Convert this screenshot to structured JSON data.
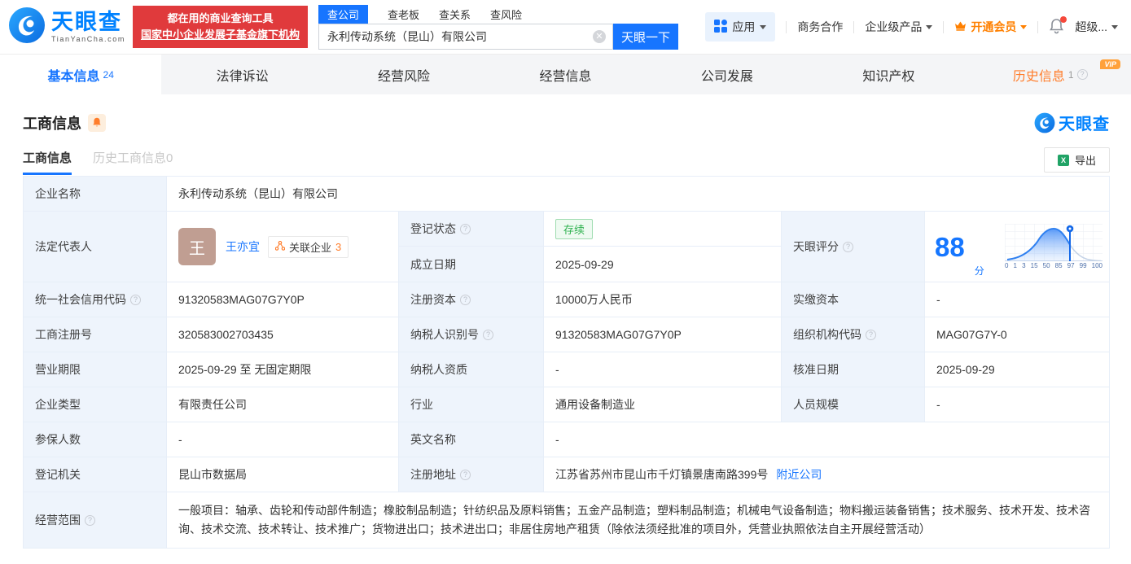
{
  "header": {
    "logo": {
      "title": "天眼查",
      "domain": "TianYanCha.com"
    },
    "slogan": {
      "line1": "都在用的商业查询工具",
      "line2": "国家中小企业发展子基金旗下机构"
    },
    "search_tabs": [
      {
        "label": "查公司",
        "active": true
      },
      {
        "label": "查老板",
        "active": false
      },
      {
        "label": "查关系",
        "active": false
      },
      {
        "label": "查风险",
        "active": false
      }
    ],
    "search": {
      "value": "永利传动系统（昆山）有限公司",
      "clear": "✕",
      "button": "天眼一下"
    },
    "nav": {
      "apps": "应用",
      "biz_coop": "商务合作",
      "enterprise": "企业级产品",
      "vip": "开通会员",
      "super": "超级..."
    }
  },
  "tabs": [
    {
      "label": "基本信息",
      "count": "24"
    },
    {
      "label": "法律诉讼"
    },
    {
      "label": "经营风险"
    },
    {
      "label": "经营信息"
    },
    {
      "label": "公司发展"
    },
    {
      "label": "知识产权"
    },
    {
      "label": "历史信息",
      "count": "1",
      "vip": "VIP"
    }
  ],
  "section": {
    "title": "工商信息",
    "watermark": "天眼查",
    "subtabs": [
      {
        "label": "工商信息",
        "active": true
      },
      {
        "label": "历史工商信息",
        "count": "0",
        "active": false
      }
    ],
    "export_label": "导出"
  },
  "table": {
    "company_name": {
      "label": "企业名称",
      "value": "永利传动系统（昆山）有限公司"
    },
    "legal_rep": {
      "label": "法定代表人",
      "avatar_char": "王",
      "name": "王亦宜",
      "related_label": "关联企业",
      "related_count": "3"
    },
    "reg_status": {
      "label": "登记状态",
      "value": "存续"
    },
    "establish_date": {
      "label": "成立日期",
      "value": "2025-09-29"
    },
    "score": {
      "label": "天眼评分",
      "value": "88",
      "unit": "分"
    },
    "credit_code": {
      "label": "统一社会信用代码",
      "value": "91320583MAG07G7Y0P"
    },
    "reg_capital": {
      "label": "注册资本",
      "value": "10000万人民币"
    },
    "paid_capital": {
      "label": "实缴资本",
      "value": "-"
    },
    "reg_number": {
      "label": "工商注册号",
      "value": "320583002703435"
    },
    "taxpayer_id": {
      "label": "纳税人识别号",
      "value": "91320583MAG07G7Y0P"
    },
    "org_code": {
      "label": "组织机构代码",
      "value": "MAG07G7Y-0"
    },
    "business_term": {
      "label": "营业期限",
      "value": "2025-09-29 至 无固定期限"
    },
    "taxpayer_quality": {
      "label": "纳税人资质",
      "value": "-"
    },
    "approval_date": {
      "label": "核准日期",
      "value": "2025-09-29"
    },
    "company_type": {
      "label": "企业类型",
      "value": "有限责任公司"
    },
    "industry": {
      "label": "行业",
      "value": "通用设备制造业"
    },
    "staff_size": {
      "label": "人员规模",
      "value": "-"
    },
    "insured_count": {
      "label": "参保人数",
      "value": "-"
    },
    "english_name": {
      "label": "英文名称",
      "value": "-"
    },
    "reg_authority": {
      "label": "登记机关",
      "value": "昆山市数据局"
    },
    "reg_address": {
      "label": "注册地址",
      "value": "江苏省苏州市昆山市千灯镇景唐南路399号",
      "nearby_link": "附近公司"
    },
    "business_scope": {
      "label": "经营范围",
      "value": "一般项目：轴承、齿轮和传动部件制造；橡胶制品制造；针纺织品及原料销售；五金产品制造；塑料制品制造；机械电气设备制造；物料搬运装备销售；技术服务、技术开发、技术咨询、技术交流、技术转让、技术推广；货物进出口；技术进出口；非居住房地产租赁（除依法须经批准的项目外，凭营业执照依法自主开展经营活动）"
    }
  },
  "chart_data": {
    "type": "area",
    "title": "天眼评分分布曲线",
    "score": 88,
    "xticks": [
      "0",
      "1",
      "3",
      "15",
      "50",
      "85",
      "97",
      "99",
      "100"
    ],
    "marker_value": 88,
    "legend_position": "none",
    "grid": true
  },
  "colors": {
    "primary_blue": "#1775ff",
    "logo_blue": "#0082ff",
    "banner_red": "#e03a3c",
    "accent_orange": "#ff7d2b",
    "status_green": "#2db14e",
    "label_cell_bg": "#eef4fc"
  }
}
